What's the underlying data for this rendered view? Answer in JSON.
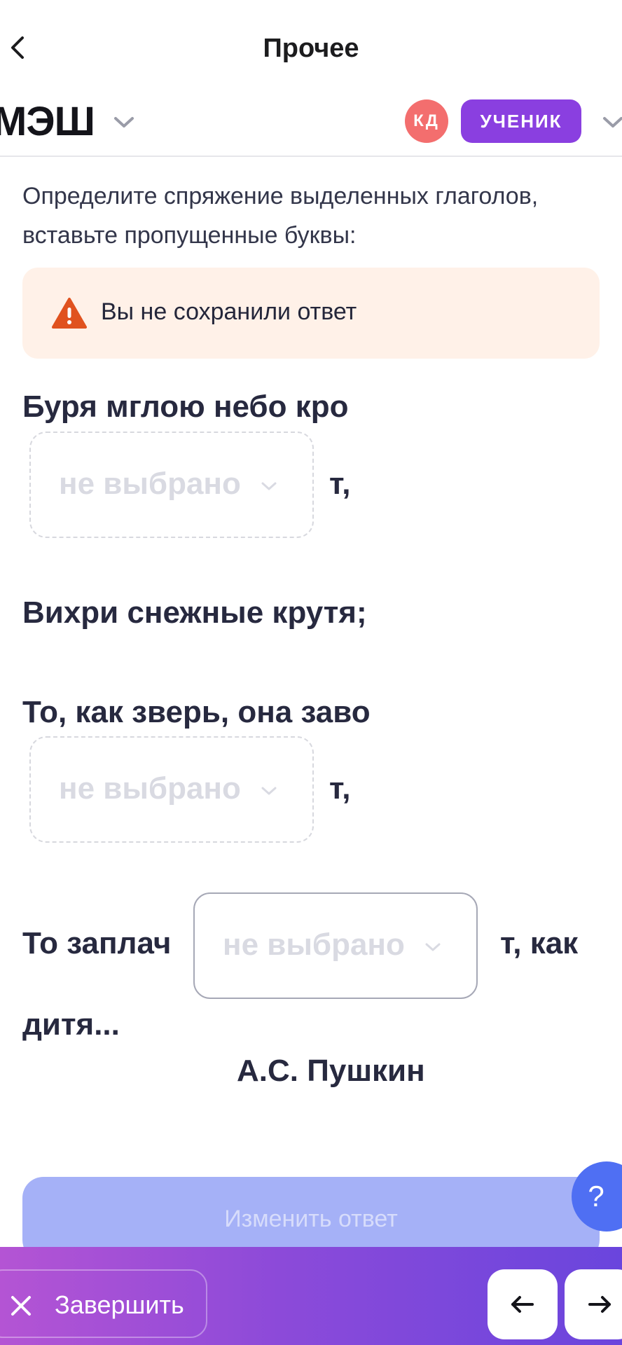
{
  "topnav": {
    "title": "Прочее"
  },
  "header": {
    "logo": "МЭШ",
    "avatar_initials": "КД",
    "role": "УЧЕНИК"
  },
  "task": {
    "instruction": "Определите спряжение выделенных глаголов, вставьте пропущенные буквы:",
    "alert": "Вы не сохранили ответ",
    "line1_start": "Буря мглою небо кро",
    "line1_end": "т,",
    "line2": "Вихри снежные крутя;",
    "line3_start": "То, как зверь, она заво",
    "line3_end": "т,",
    "line4_start": "То заплач",
    "line4_end": "т, как",
    "line4_cont": "дитя...",
    "author": "А.С. Пушкин",
    "selects": [
      {
        "value": "не выбрано"
      },
      {
        "value": "не выбрано"
      },
      {
        "value": "не выбрано"
      }
    ]
  },
  "actions": {
    "change_answer": "Изменить ответ",
    "help": "?",
    "finish": "Завершить",
    "prev": "←",
    "next": "→"
  },
  "colors": {
    "accent_purple": "#8a3fe0",
    "avatar_red": "#f36e6e",
    "alert_bg": "#fff1e8",
    "alert_icon": "#e0521f",
    "button_disabled": "#a5b1f7",
    "help_blue": "#4f6ff3"
  }
}
